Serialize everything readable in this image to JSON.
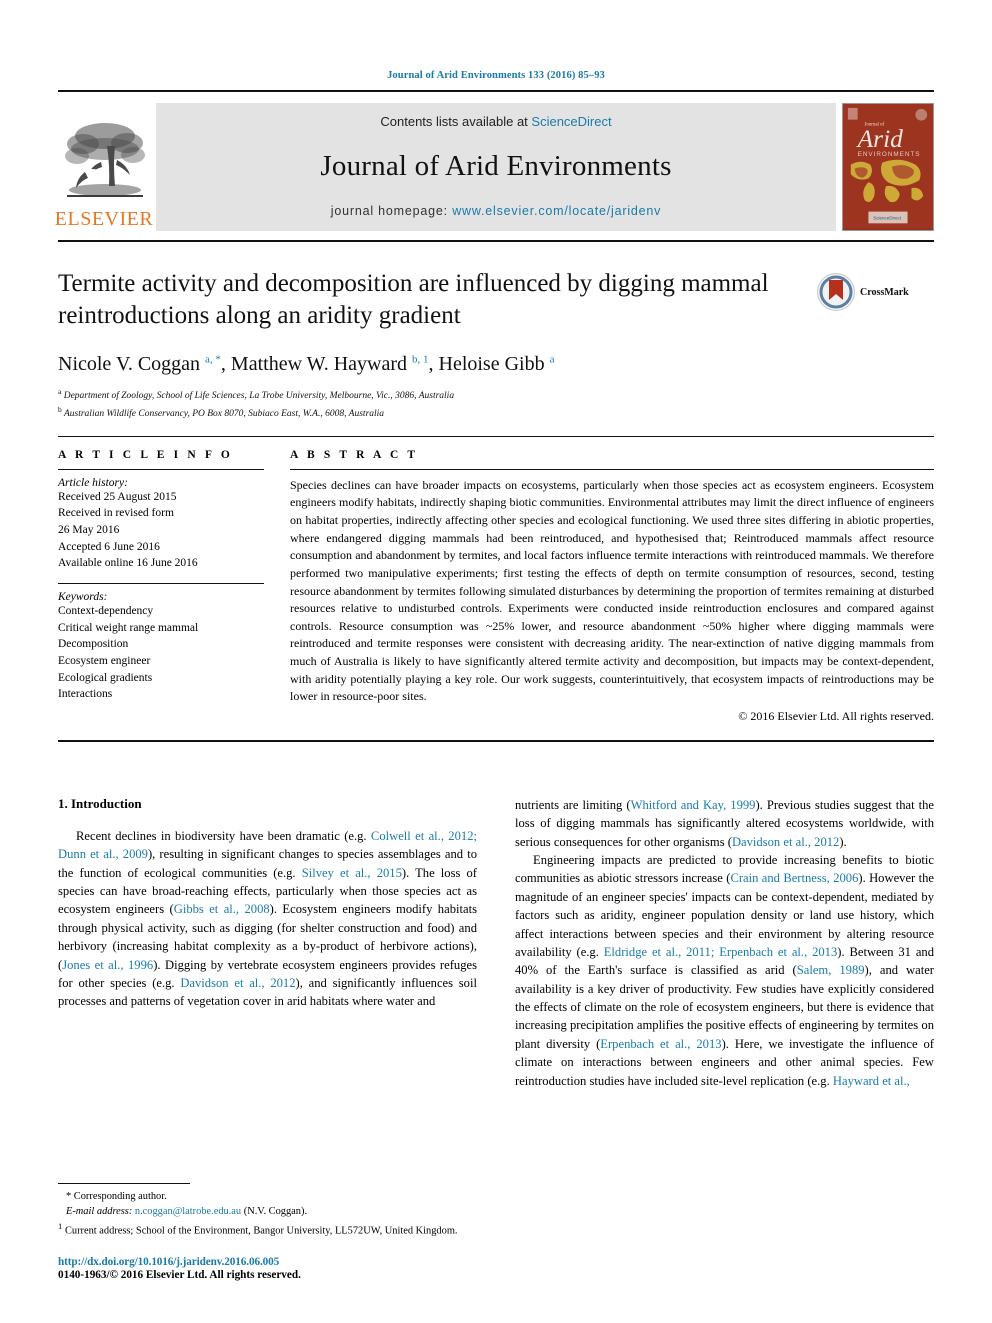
{
  "running_head": "Journal of Arid Environments 133 (2016) 85–93",
  "masthead": {
    "contents_prefix": "Contents lists available at ",
    "contents_link": "ScienceDirect",
    "journal_title": "Journal of Arid Environments",
    "homepage_prefix": "journal homepage: ",
    "homepage_link": "www.elsevier.com/locate/jaridenv",
    "publisher_logo_text": "ELSEVIER",
    "cover_title_small": "Journal of",
    "cover_title_main": "Arid",
    "cover_subtitle": "ENVIRONMENTS",
    "cover_footer": "ScienceDirect"
  },
  "article": {
    "title": "Termite activity and decomposition are influenced by digging mammal reintroductions along an aridity gradient",
    "authors_html": "Nicole V. Coggan <sup>a, *</sup>, Matthew W. Hayward <sup>b, 1</sup>, Heloise Gibb <sup>a</sup>",
    "affiliation_a": "Department of Zoology, School of Life Sciences, La Trobe University, Melbourne, Vic., 3086, Australia",
    "affiliation_b": "Australian Wildlife Conservancy, PO Box 8070, Subiaco East, W.A., 6008, Australia",
    "crossmark_label": "CrossMark"
  },
  "article_info": {
    "heading": "A R T I C L E   I N F O",
    "history_label": "Article history:",
    "history": [
      "Received 25 August 2015",
      "Received in revised form",
      "26 May 2016",
      "Accepted 6 June 2016",
      "Available online 16 June 2016"
    ],
    "keywords_label": "Keywords:",
    "keywords": [
      "Context-dependency",
      "Critical weight range mammal",
      "Decomposition",
      "Ecosystem engineer",
      "Ecological gradients",
      "Interactions"
    ]
  },
  "abstract": {
    "heading": "A B S T R A C T",
    "text": "Species declines can have broader impacts on ecosystems, particularly when those species act as ecosystem engineers. Ecosystem engineers modify habitats, indirectly shaping biotic communities. Environmental attributes may limit the direct influence of engineers on habitat properties, indirectly affecting other species and ecological functioning. We used three sites differing in abiotic properties, where endangered digging mammals had been reintroduced, and hypothesised that; Reintroduced mammals affect resource consumption and abandonment by termites, and local factors influence termite interactions with reintroduced mammals. We therefore performed two manipulative experiments; first testing the effects of depth on termite consumption of resources, second, testing resource abandonment by termites following simulated disturbances by determining the proportion of termites remaining at disturbed resources relative to undisturbed controls. Experiments were conducted inside reintroduction enclosures and compared against controls. Resource consumption was ~25% lower, and resource abandonment ~50% higher where digging mammals were reintroduced and termite responses were consistent with decreasing aridity. The near-extinction of native digging mammals from much of Australia is likely to have significantly altered termite activity and decomposition, but impacts may be context-dependent, with aridity potentially playing a key role. Our work suggests, counterintuitively, that ecosystem impacts of reintroductions may be lower in resource-poor sites.",
    "copyright": "© 2016 Elsevier Ltd. All rights reserved."
  },
  "introduction": {
    "heading": "1. Introduction",
    "left_paragraph_segments": [
      {
        "t": "Recent declines in biodiversity have been dramatic (e.g. ",
        "c": false
      },
      {
        "t": "Colwell et al., 2012; Dunn et al., 2009",
        "c": true
      },
      {
        "t": "), resulting in significant changes to species assemblages and to the function of ecological communities (e.g. ",
        "c": false
      },
      {
        "t": "Silvey et al., 2015",
        "c": true
      },
      {
        "t": "). The loss of species can have broad-reaching effects, particularly when those species act as ecosystem engineers (",
        "c": false
      },
      {
        "t": "Gibbs et al., 2008",
        "c": true
      },
      {
        "t": "). Ecosystem engineers modify habitats through physical activity, such as digging (for shelter construction and food) and herbivory (increasing habitat complexity as a by-product of herbivore actions), (",
        "c": false
      },
      {
        "t": "Jones et al., 1996",
        "c": true
      },
      {
        "t": "). Digging by vertebrate ecosystem engineers provides refuges for other species (e.g. ",
        "c": false
      },
      {
        "t": "Davidson et al., 2012",
        "c": true
      },
      {
        "t": "), and significantly influences soil processes and patterns of vegetation cover in arid habitats where water and",
        "c": false
      }
    ],
    "right_paragraph1_segments": [
      {
        "t": "nutrients are limiting (",
        "c": false
      },
      {
        "t": "Whitford and Kay, 1999",
        "c": true
      },
      {
        "t": "). Previous studies suggest that the loss of digging mammals has significantly altered ecosystems worldwide, with serious consequences for other organisms (",
        "c": false
      },
      {
        "t": "Davidson et al., 2012",
        "c": true
      },
      {
        "t": ").",
        "c": false
      }
    ],
    "right_paragraph2_segments": [
      {
        "t": "Engineering impacts are predicted to provide increasing benefits to biotic communities as abiotic stressors increase (",
        "c": false
      },
      {
        "t": "Crain and Bertness, 2006",
        "c": true
      },
      {
        "t": "). However the magnitude of an engineer species' impacts can be context-dependent, mediated by factors such as aridity, engineer population density or land use history, which affect interactions between species and their environment by altering resource availability (e.g. ",
        "c": false
      },
      {
        "t": "Eldridge et al., 2011; Erpenbach et al., 2013",
        "c": true
      },
      {
        "t": "). Between 31 and 40% of the Earth's surface is classified as arid (",
        "c": false
      },
      {
        "t": "Salem, 1989",
        "c": true
      },
      {
        "t": "), and water availability is a key driver of productivity. Few studies have explicitly considered the effects of climate on the role of ecosystem engineers, but there is evidence that increasing precipitation amplifies the positive effects of engineering by termites on plant diversity (",
        "c": false
      },
      {
        "t": "Erpenbach et al., 2013",
        "c": true
      },
      {
        "t": "). Here, we investigate the influence of climate on interactions between engineers and other animal species. Few reintroduction studies have included site-level replication (e.g. ",
        "c": false
      },
      {
        "t": "Hayward et al.,",
        "c": true
      }
    ]
  },
  "footnotes": {
    "corresponding": "Corresponding author.",
    "email_label": "E-mail address:",
    "email": "n.coggan@latrobe.edu.au",
    "email_suffix": "(N.V. Coggan).",
    "current_address": "Current address; School of the Environment, Bangor University, LL572UW, United Kingdom.",
    "doi": "http://dx.doi.org/10.1016/j.jaridenv.2016.06.005",
    "issn": "0140-1963/© 2016 Elsevier Ltd. All rights reserved."
  }
}
